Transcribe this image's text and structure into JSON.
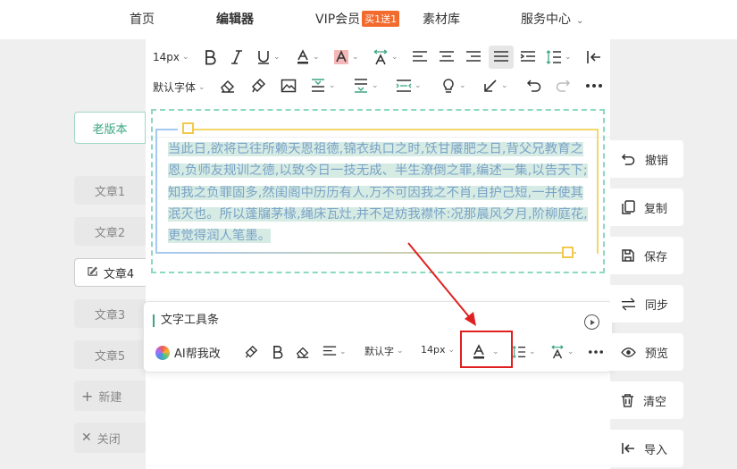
{
  "nav": {
    "home": "首页",
    "editor": "编辑器",
    "vip": "VIP会员",
    "vip_badge": "买1送1",
    "materials": "素材库",
    "service": "服务中心"
  },
  "sidebar": {
    "old_version": "老版本",
    "chapters": [
      "文章1",
      "文章2",
      "文章4",
      "文章3",
      "文章5"
    ],
    "new": "新建",
    "close": "关闭"
  },
  "toolbar": {
    "font_size": "14px",
    "font_family": "默认字体"
  },
  "content": {
    "text": "当此日,欲将已往所赖天恩祖德,锦衣纨口之时,饫甘餍肥之日,背父兄教育之恩,负师友规训之德,以致今日一技无成、半生潦倒之罪,编述一集,以告天下;知我之负罪固多,然闺阁中历历有人,万不可因我之不肖,自护己短,一并使其泯灭也。所以蓬牖茅椽,绳床瓦灶,并不足妨我襟怀:况那晨风夕月,阶柳庭花,更觉得润人笔墨。"
  },
  "float_toolbar": {
    "title": "文字工具条",
    "ai": "AI帮我改",
    "font_family": "默认字",
    "font_size": "14px"
  },
  "actions": [
    "撤销",
    "复制",
    "保存",
    "同步",
    "预览",
    "清空",
    "导入"
  ],
  "colors": {
    "accent": "#3aa57f",
    "vip_badge": "#f26b2d",
    "highlight_box": "#e02020"
  }
}
